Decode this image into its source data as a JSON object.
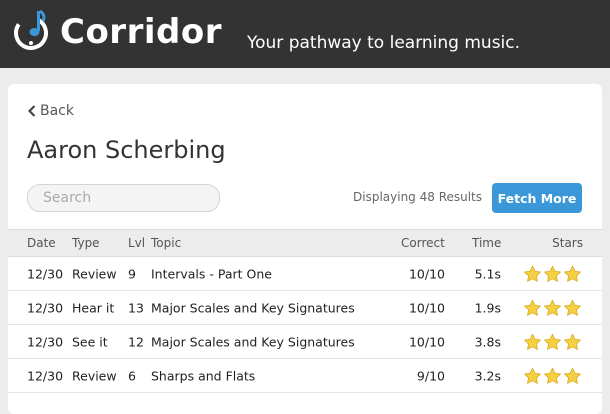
{
  "header": {
    "brand": "Corridor",
    "tagline": "Your pathway to learning music.",
    "logo_icon": "music-note-circle-icon"
  },
  "page": {
    "back_label": "Back",
    "title": "Aaron Scherbing",
    "search_placeholder": "Search",
    "results_text": "Displaying 48 Results",
    "fetch_label": "Fetch More"
  },
  "table": {
    "columns": {
      "date": "Date",
      "type": "Type",
      "lvl": "Lvl",
      "topic": "Topic",
      "correct": "Correct",
      "time": "Time",
      "stars": "Stars"
    },
    "rows": [
      {
        "date": "12/30",
        "type": "Review",
        "lvl": "9",
        "topic": "Intervals - Part One",
        "correct": "10/10",
        "time": "5.1s",
        "stars": 3
      },
      {
        "date": "12/30",
        "type": "Hear it",
        "lvl": "13",
        "topic": "Major Scales and Key Signatures",
        "correct": "10/10",
        "time": "1.9s",
        "stars": 3
      },
      {
        "date": "12/30",
        "type": "See it",
        "lvl": "12",
        "topic": "Major Scales and Key Signatures",
        "correct": "10/10",
        "time": "3.8s",
        "stars": 3
      },
      {
        "date": "12/30",
        "type": "Review",
        "lvl": "6",
        "topic": "Sharps and Flats",
        "correct": "9/10",
        "time": "3.2s",
        "stars": 3
      }
    ]
  },
  "colors": {
    "topbar": "#333333",
    "accent": "#3a98d8",
    "star": "#f5d042"
  }
}
